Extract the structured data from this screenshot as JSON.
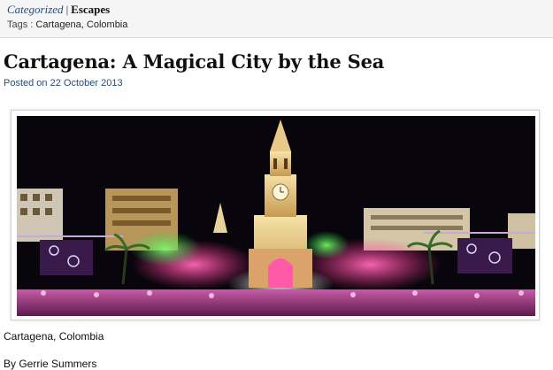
{
  "category_bar": {
    "label": "Categorized",
    "separator": "|",
    "category": "Escapes",
    "tags_label": "Tags :",
    "tags": "Cartagena, Colombia"
  },
  "post": {
    "title": "Cartagena: A Magical City by the Sea",
    "posted_prefix": "Posted on",
    "date": "22 October 2013",
    "caption": "Cartagena, Colombia",
    "byline": "By Gerrie Summers"
  },
  "colors": {
    "link_blue": "#2a4a7a",
    "night_sky": "#08060c",
    "tower_light": "#f0d89a",
    "stage_pink": "#e0338f",
    "stage_green": "#3fd85a"
  }
}
